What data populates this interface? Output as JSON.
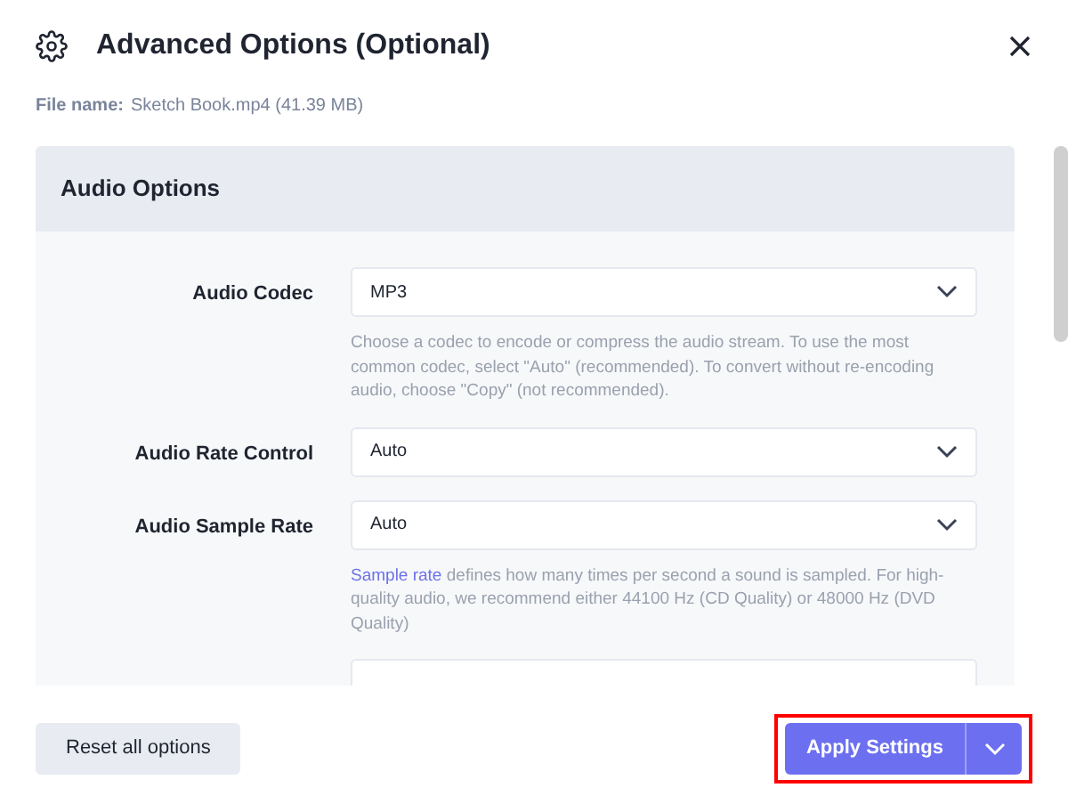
{
  "dialog": {
    "title": "Advanced Options (Optional)",
    "file_label": "File name:",
    "file_value": "Sketch Book.mp4 (41.39 MB)"
  },
  "section": {
    "title": "Audio Options",
    "fields": [
      {
        "label": "Audio Codec",
        "value": "MP3",
        "help": "Choose a codec to encode or compress the audio stream. To use the most common codec, select \"Auto\" (recommended). To convert without re-encoding audio, choose \"Copy\" (not recommended)."
      },
      {
        "label": "Audio Rate Control",
        "value": "Auto"
      },
      {
        "label": "Audio Sample Rate",
        "value": "Auto",
        "help_link": "Sample rate",
        "help": " defines how many times per second a sound is sampled. For high-quality audio, we recommend either 44100 Hz (CD Quality) or 48000 Hz (DVD Quality)"
      }
    ],
    "more_below": true
  },
  "footer": {
    "reset": "Reset all options",
    "apply": "Apply Settings",
    "highlighted": true
  }
}
